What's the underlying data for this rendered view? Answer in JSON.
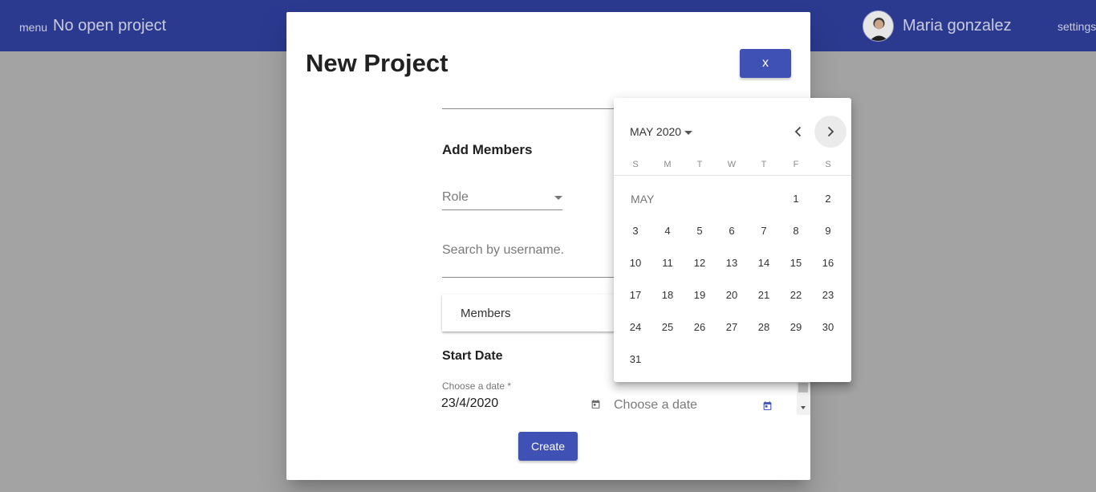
{
  "topbar": {
    "menu_label": "menu",
    "project_title": "No open project",
    "user_name": "Maria gonzalez",
    "settings_label": "settings",
    "background": "#2b3a8f"
  },
  "dialog": {
    "title": "New Project",
    "close_label": "x",
    "add_members_title": "Add Members",
    "role_label": "Role",
    "search_placeholder": "Search by username.",
    "members_label": "Members",
    "start_date_title": "Start Date",
    "date_label": "Choose a date *",
    "date_value": "23/4/2020",
    "end_date_placeholder": "Choose a date",
    "create_label": "Create",
    "accent": "#3f51b5"
  },
  "calendar": {
    "period_label": "MAY 2020",
    "month_label": "MAY",
    "weekdays": [
      "S",
      "M",
      "T",
      "W",
      "T",
      "F",
      "S"
    ],
    "first_weekday_index": 5,
    "days_in_month": 31,
    "prev_icon": "chevron-left-icon",
    "next_icon": "chevron-right-icon"
  }
}
